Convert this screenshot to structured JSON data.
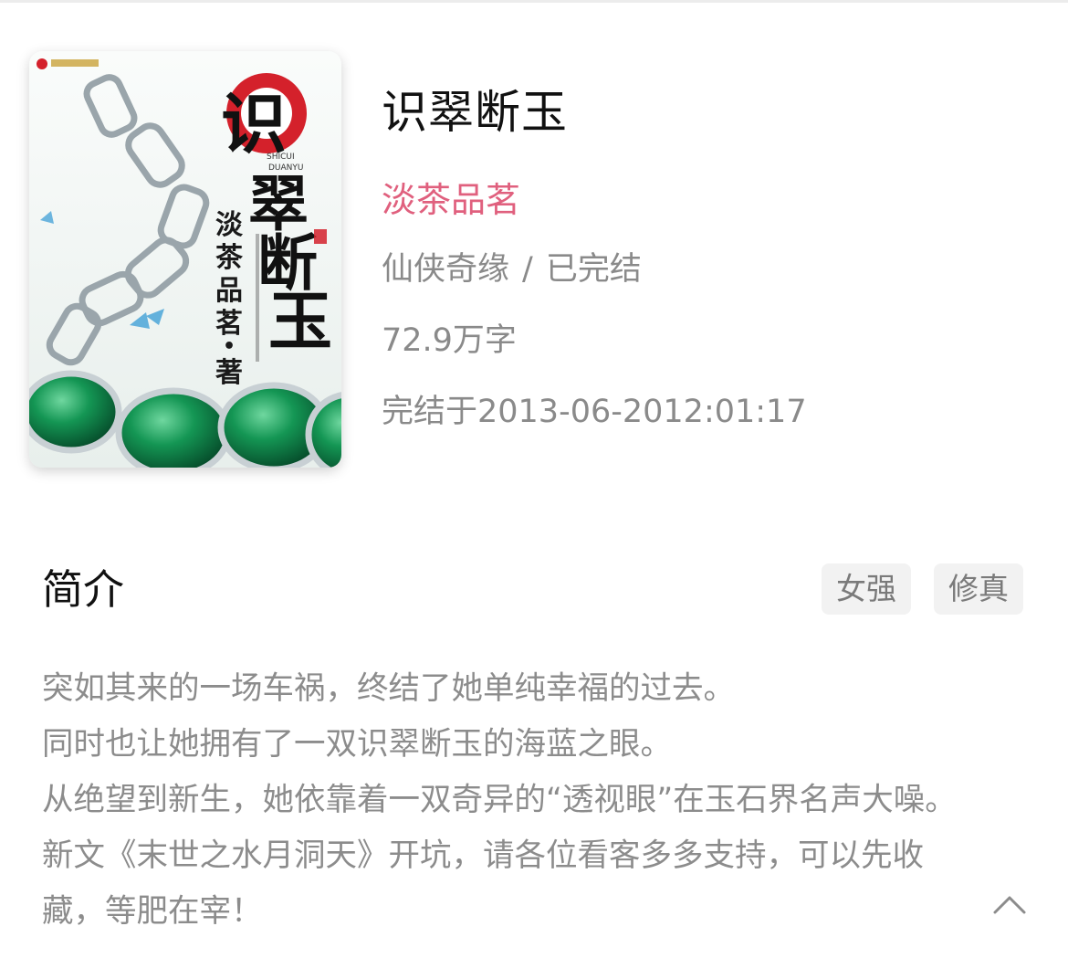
{
  "book": {
    "title": "识翠断玉",
    "author": "淡茶品茗",
    "category": "仙侠奇缘",
    "separator": "/",
    "status": "已完结",
    "word_count": "72.9万字",
    "finished_at": "完结于2013-06-2012:01:17",
    "cover": {
      "title_text": "识翠断玉",
      "author_text": "淡茶品茗 • 著",
      "pinyin_text": "SHICUI DUANYU",
      "accent_color": "#d4212b",
      "jade_color": "#0f8a4e"
    }
  },
  "intro_section": {
    "title": "简介",
    "tags": [
      "女强",
      "修真"
    ],
    "paragraphs": [
      "突如其来的一场车祸，终结了她单纯幸福的过去。",
      "同时也让她拥有了一双识翠断玉的海蓝之眼。",
      "从绝望到新生，她依靠着一双奇异的“透视眼”在玉石界名声大噪。",
      "新文《末世之水月洞天》开坑，请各位看客多多支持，可以先收",
      "藏，等肥在宰！"
    ],
    "collapse_icon": "chevron-up-icon"
  },
  "colors": {
    "author": "#e0607e",
    "meta_text": "#8a8a8a",
    "tag_bg": "#f2f2f2"
  }
}
